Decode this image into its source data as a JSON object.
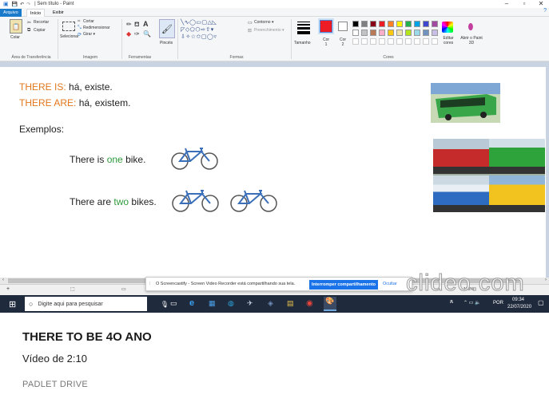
{
  "window": {
    "title": "| Sem título - Paint",
    "minimize": "–",
    "maximize": "▫",
    "close": "✕"
  },
  "ribbon_tabs": [
    "Arquivo",
    "Início",
    "Exibir"
  ],
  "ribbon": {
    "colar": "Colar",
    "recortar": "Recortar",
    "copiar": "Copiar",
    "area_transferencia": "Área de Transferência",
    "cortar": "Cortar",
    "redimensionar": "Redimensionar",
    "girar": "Girar ▾",
    "selecionar": "Selecionar",
    "imagem": "Imagem",
    "ferramentas": "Ferramentas",
    "pinceis": "Pincéis",
    "contorno": "Contorno ▾",
    "preenchimento": "Preenchimento ▾",
    "formas": "Formas",
    "tamanho": "Tamanho",
    "cor1": "Cor 1",
    "cor2": "Cor 2",
    "cores": "Cores",
    "editar_cores": "Editar cores",
    "abrir_paint3d": "Abrir o Paint 3D"
  },
  "palette": [
    "#000000",
    "#7f7f7f",
    "#880015",
    "#ed1c24",
    "#ff7f27",
    "#fff200",
    "#22b14c",
    "#00a2e8",
    "#3f48cc",
    "#a349a4",
    "#ffffff",
    "#c3c3c3",
    "#b97a57",
    "#ffaec9",
    "#ffc90e",
    "#efe4b0",
    "#b5e61d",
    "#99d9ea",
    "#7092be",
    "#c8bfe7"
  ],
  "canvas": {
    "line1_label": "THERE IS:",
    "line1_text": "há, existe.",
    "line2_label": "THERE ARE:",
    "line2_text": "há, existem.",
    "examples": "Exemplos:",
    "ex1_a": "There is",
    "ex1_hl": "one",
    "ex1_b": "bike.",
    "ex2_a": "There are",
    "ex2_hl": "two",
    "ex2_b": "bikes.",
    "accent_orange": "#e2771c",
    "accent_green": "#2e9a3a"
  },
  "share_banner": {
    "text": "O Screencastify - Screen Video Recorder está compartilhando sua tela.",
    "button": "Interromper compartilhamento",
    "ocultar": "Ocultar"
  },
  "watermark": "clideo.com",
  "statusbar": {
    "zoom": "100%"
  },
  "taskbar": {
    "search_placeholder": "Digite aqui para pesquisar",
    "lang": "POR",
    "time": "09:34",
    "date": "22/07/2020"
  },
  "video": {
    "title": "THERE TO BE 4O ANO",
    "duration": "Vídeo de 2:10",
    "source": "PADLET DRIVE"
  }
}
